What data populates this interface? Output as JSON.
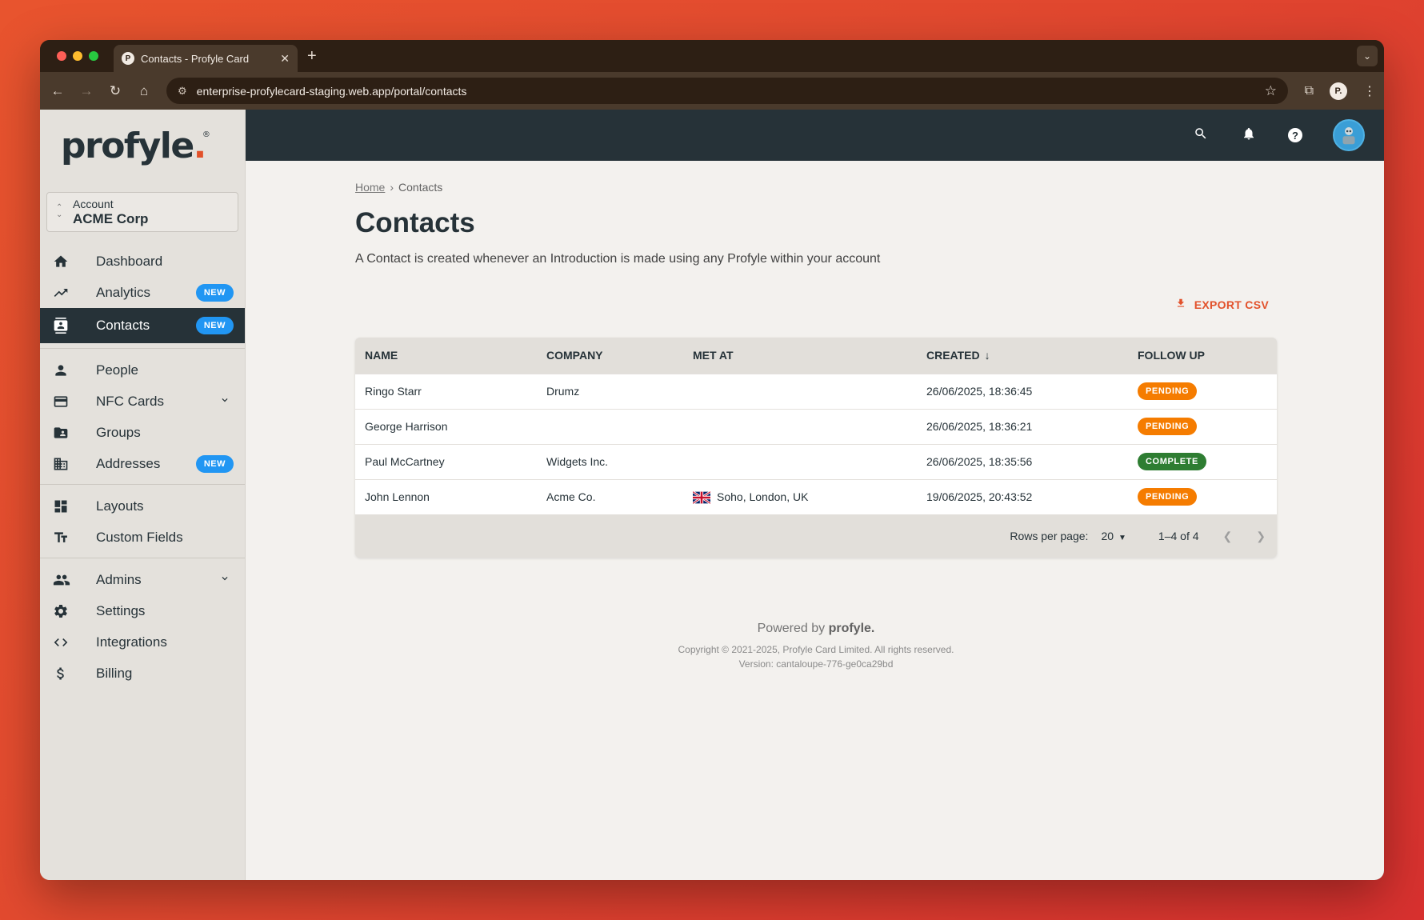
{
  "browser": {
    "tab_title": "Contacts - Profyle Card",
    "tab_favicon_letter": "P",
    "url": "enterprise-profylecard-staging.web.app/portal/contacts",
    "profile_initial": "P."
  },
  "sidebar": {
    "logo_text": "profyle",
    "logo_dot": ".",
    "logo_reg": "®",
    "account": {
      "label": "Account",
      "value": "ACME Corp"
    },
    "items": [
      {
        "label": "Dashboard",
        "icon": "home-icon"
      },
      {
        "label": "Analytics",
        "icon": "trending-up-icon",
        "badge": "NEW"
      },
      {
        "label": "Contacts",
        "icon": "contact-card-icon",
        "badge": "NEW",
        "active": true
      },
      {
        "label": "People",
        "icon": "person-icon"
      },
      {
        "label": "NFC Cards",
        "icon": "credit-card-icon",
        "expandable": true
      },
      {
        "label": "Groups",
        "icon": "folder-shared-icon"
      },
      {
        "label": "Addresses",
        "icon": "building-icon",
        "badge": "NEW"
      },
      {
        "label": "Layouts",
        "icon": "dashboard-layout-icon"
      },
      {
        "label": "Custom Fields",
        "icon": "text-fields-icon"
      },
      {
        "label": "Admins",
        "icon": "people-icon",
        "expandable": true
      },
      {
        "label": "Settings",
        "icon": "gear-icon"
      },
      {
        "label": "Integrations",
        "icon": "code-icon"
      },
      {
        "label": "Billing",
        "icon": "dollar-icon"
      }
    ]
  },
  "breadcrumb": {
    "home": "Home",
    "separator": "›",
    "current": "Contacts"
  },
  "main": {
    "title": "Contacts",
    "description": "A Contact is created whenever an Introduction is made using any Profyle within your account",
    "export_label": "EXPORT CSV"
  },
  "table": {
    "columns": [
      "NAME",
      "COMPANY",
      "MET AT",
      "CREATED",
      "FOLLOW UP"
    ],
    "sort_indicator": "↓",
    "rows": [
      {
        "name": "Ringo Starr",
        "company": "Drumz",
        "met_at": "",
        "created": "26/06/2025, 18:36:45",
        "status": "PENDING"
      },
      {
        "name": "George Harrison",
        "company": "",
        "met_at": "",
        "created": "26/06/2025, 18:36:21",
        "status": "PENDING"
      },
      {
        "name": "Paul McCartney",
        "company": "Widgets Inc.",
        "met_at": "",
        "created": "26/06/2025, 18:35:56",
        "status": "COMPLETE"
      },
      {
        "name": "John Lennon",
        "company": "Acme Co.",
        "met_at": "Soho, London, UK",
        "met_at_flag": "uk-flag-icon",
        "created": "19/06/2025, 20:43:52",
        "status": "PENDING"
      }
    ],
    "status_colors": {
      "PENDING": "#f57c00",
      "COMPLETE": "#2e7d32"
    },
    "pagination": {
      "rows_per_page_label": "Rows per page:",
      "rows_per_page": "20",
      "range": "1–4 of 4"
    }
  },
  "footer": {
    "powered_by": "Powered by",
    "powered_brand": "profyle.",
    "copyright": "Copyright © 2021-2025, Profyle Card Limited. All rights reserved.",
    "version": "Version: cantaloupe-776-ge0ca29bd"
  },
  "colors": {
    "sidebar_active": "#263238",
    "topbar": "#263238",
    "accent": "#e2512a",
    "badge": "#2196f3"
  }
}
